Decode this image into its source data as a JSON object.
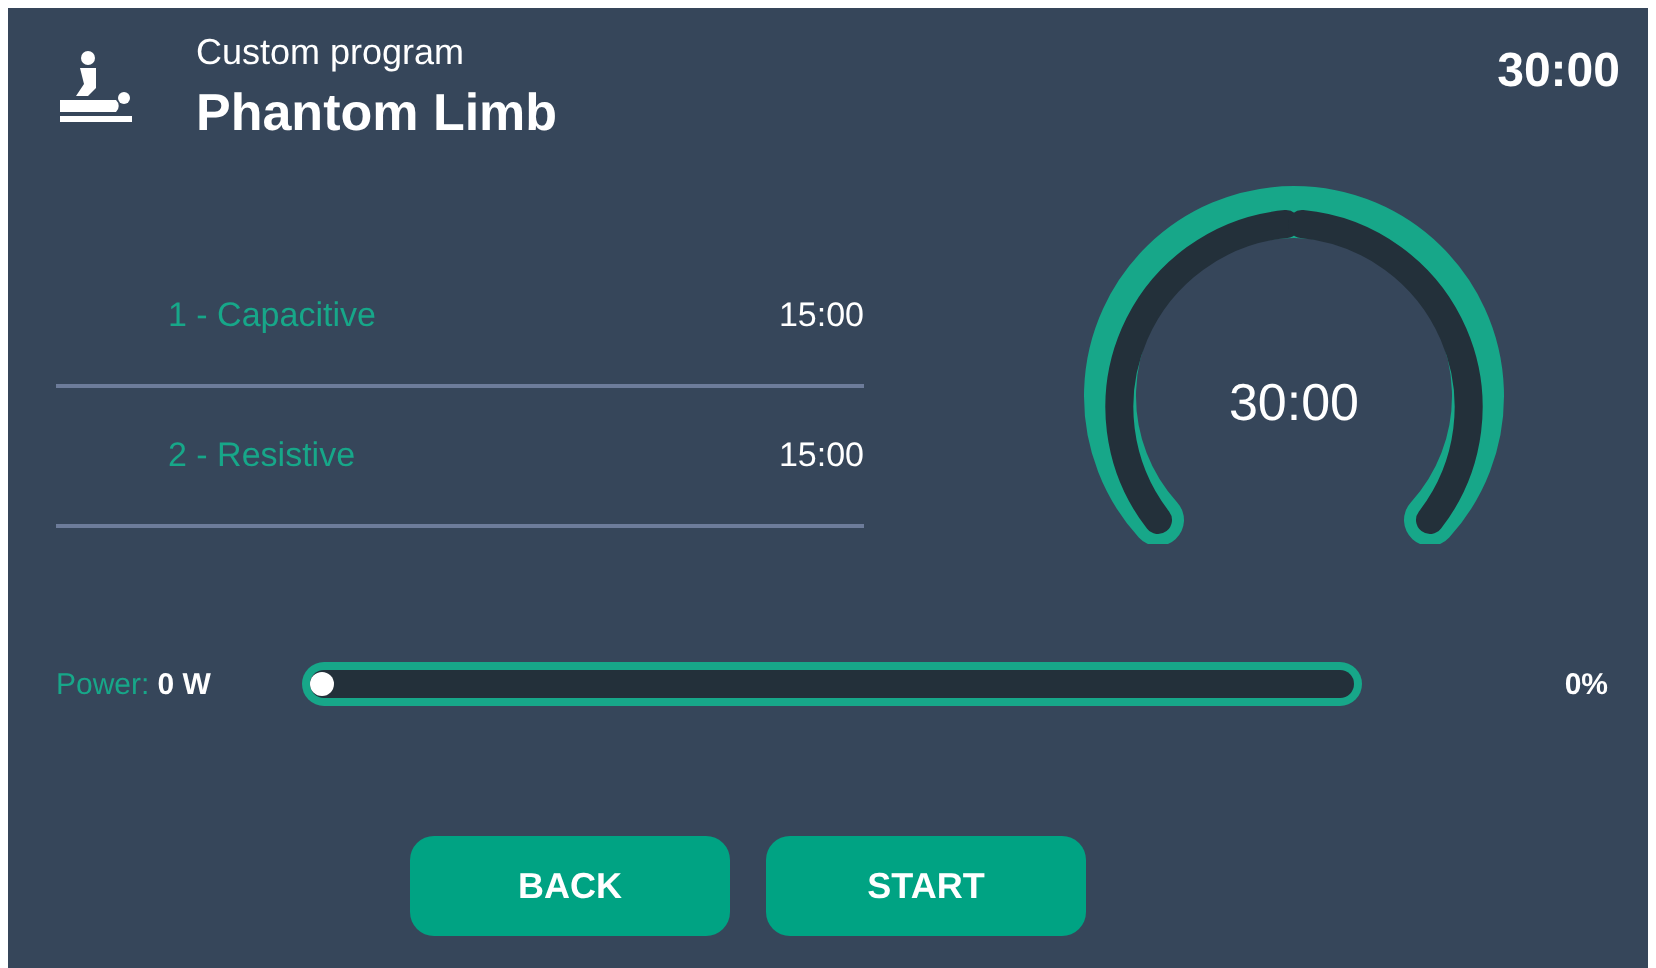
{
  "header": {
    "subtitle": "Custom program",
    "title": "Phantom Limb",
    "total_time": "30:00"
  },
  "phases": [
    {
      "name": "1 - Capacitive",
      "time": "15:00"
    },
    {
      "name": "2 - Resistive",
      "time": "15:00"
    }
  ],
  "timer": {
    "reading": "30:00"
  },
  "power": {
    "label": "Power:",
    "value": "0 W",
    "level": 0,
    "reading": "0%"
  },
  "buttons": [
    "BACK",
    "START"
  ]
}
